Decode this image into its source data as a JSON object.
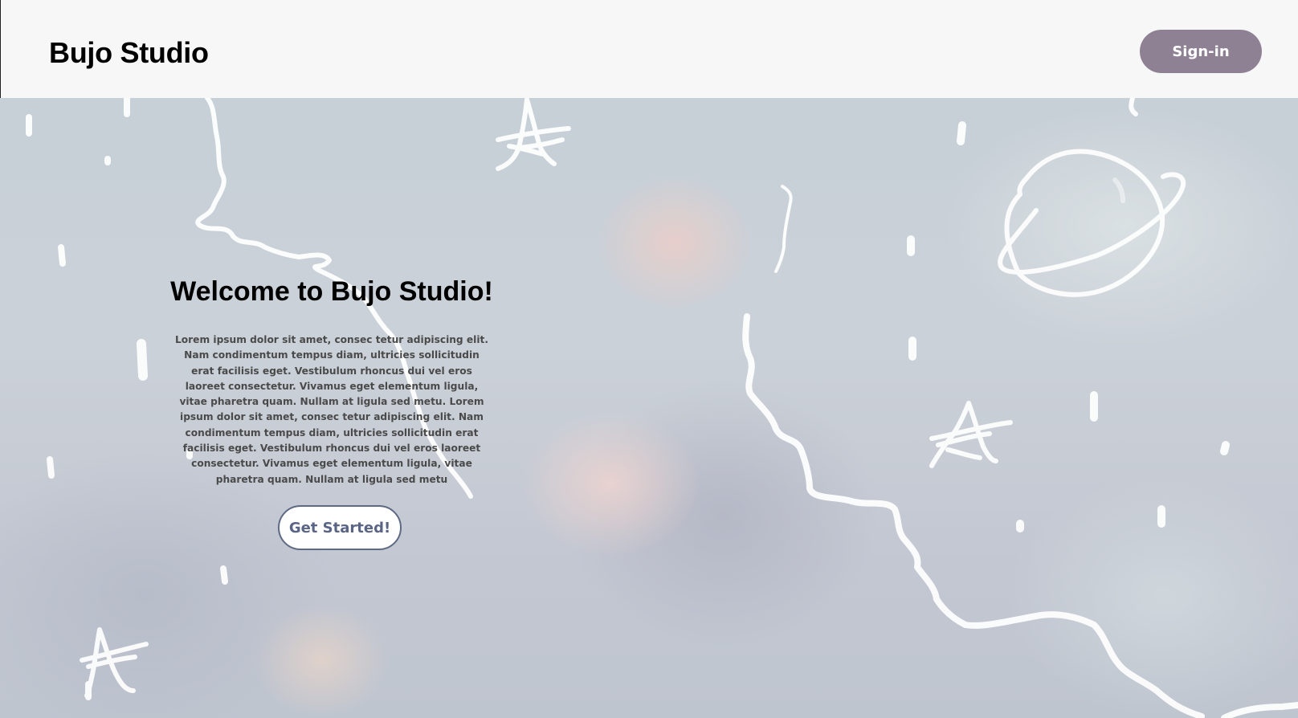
{
  "header": {
    "brand": "Bujo Studio",
    "signin_label": "Sign-in"
  },
  "hero": {
    "title": "Welcome to Bujo Studio!",
    "body": "Lorem ipsum dolor sit amet, consec tetur adipiscing elit. Nam condimentum tempus diam, ultricies sollicitudin erat facilisis eget. Vestibulum rhoncus dui vel eros laoreet consectetur. Vivamus eget elementum ligula, vitae pharetra quam. Nullam at ligula sed metu. Lorem ipsum dolor sit amet, consec tetur adipiscing elit. Nam condimentum tempus diam, ultricies sollicitudin erat facilisis eget. Vestibulum rhoncus dui vel eros laoreet consectetur. Vivamus eget elementum ligula, vitae pharetra quam. Nullam at ligula sed metu",
    "cta_label": "Get Started!"
  },
  "colors": {
    "header_bg": "#f7f7f7",
    "signin_bg": "#8f8194",
    "cta_border": "#5e6a83",
    "doodle_stroke": "#ffffff"
  },
  "background": {
    "icons": [
      "star-icon",
      "planet-icon",
      "squiggle-line-icon",
      "rain-dash-icon"
    ]
  }
}
